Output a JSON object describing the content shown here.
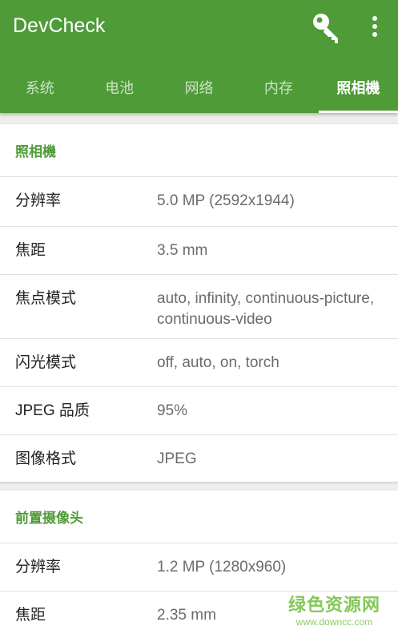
{
  "app": {
    "title": "DevCheck",
    "icons": [
      "key-icon",
      "more-vert-icon"
    ],
    "accent_color": "#4e9b37"
  },
  "tabs": [
    {
      "label": "系统",
      "active": false
    },
    {
      "label": "电池",
      "active": false
    },
    {
      "label": "网络",
      "active": false
    },
    {
      "label": "内存",
      "active": false
    },
    {
      "label": "照相機",
      "active": true
    }
  ],
  "sections": [
    {
      "title": "照相機",
      "rows": [
        {
          "label": "分辨率",
          "value": "5.0 MP (2592x1944)"
        },
        {
          "label": "焦距",
          "value": "3.5 mm"
        },
        {
          "label": "焦点模式",
          "value": "auto, infinity, continuous-picture, continuous-video"
        },
        {
          "label": "闪光模式",
          "value": "off, auto, on, torch"
        },
        {
          "label": "JPEG 品质",
          "value": "95%"
        },
        {
          "label": "图像格式",
          "value": "JPEG"
        }
      ]
    },
    {
      "title": "前置摄像头",
      "rows": [
        {
          "label": "分辨率",
          "value": "1.2 MP (1280x960)"
        },
        {
          "label": "焦距",
          "value": "2.35 mm"
        }
      ]
    }
  ],
  "watermark": {
    "text": "绿色资源网",
    "url": "www.downcc.com"
  }
}
